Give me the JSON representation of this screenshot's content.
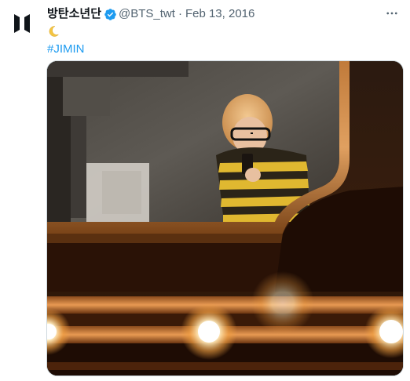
{
  "tweet": {
    "display_name": "방탄소년단",
    "handle": "@BTS_twt",
    "separator": "·",
    "date": "Feb 13, 2016",
    "text_emoji": "crescent-moon",
    "hashtag": "#JIMIN",
    "more_icon": "ellipsis-icon",
    "verified_icon": "verified-badge-icon",
    "avatar_icon": "bts-logo-icon"
  },
  "colors": {
    "link": "#1d9bf0",
    "text": "#0f1419",
    "secondary": "#536471",
    "verified": "#1d9bf0"
  }
}
